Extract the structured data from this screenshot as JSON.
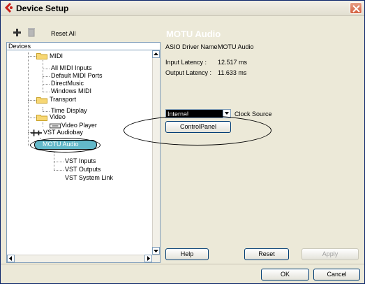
{
  "window": {
    "title": "Device Setup",
    "close_icon": "close-icon",
    "accent_color": "#0A246A"
  },
  "toolbar": {
    "add_icon": "plus-icon",
    "remove_icon": "trash-icon",
    "reset_all_label": "Reset All"
  },
  "devices_panel": {
    "header": "Devices",
    "tree": {
      "midi": "MIDI",
      "all_midi_inputs": "All MIDI Inputs",
      "default_midi_ports": "Default MIDI Ports",
      "directmusic": "DirectMusic",
      "windows_midi": "Windows MIDI",
      "transport": "Transport",
      "time_display": "Time Display",
      "video": "Video",
      "video_player": "Video Player",
      "vst_audiobay": "VST Audiobay",
      "motu_audio": "MOTU Audio",
      "vst_inputs": "VST Inputs",
      "vst_outputs": "VST Outputs",
      "vst_system_link": "VST System Link"
    },
    "selected_color": "#63B8C9"
  },
  "details_panel": {
    "title": "MOTU Audio",
    "asio_driver_label": "ASIO Driver Name",
    "asio_driver_value": "MOTU Audio",
    "input_latency_label": "Input Latency :",
    "input_latency_value": "12.517 ms",
    "output_latency_label": "Output Latency :",
    "output_latency_value": "11.633 ms",
    "clock_source_value": "Internal",
    "clock_source_label": "Clock Source",
    "control_panel_label": "ControlPanel"
  },
  "bottom": {
    "help_label": "Help",
    "reset_label": "Reset",
    "apply_label": "Apply",
    "ok_label": "OK",
    "cancel_label": "Cancel"
  }
}
